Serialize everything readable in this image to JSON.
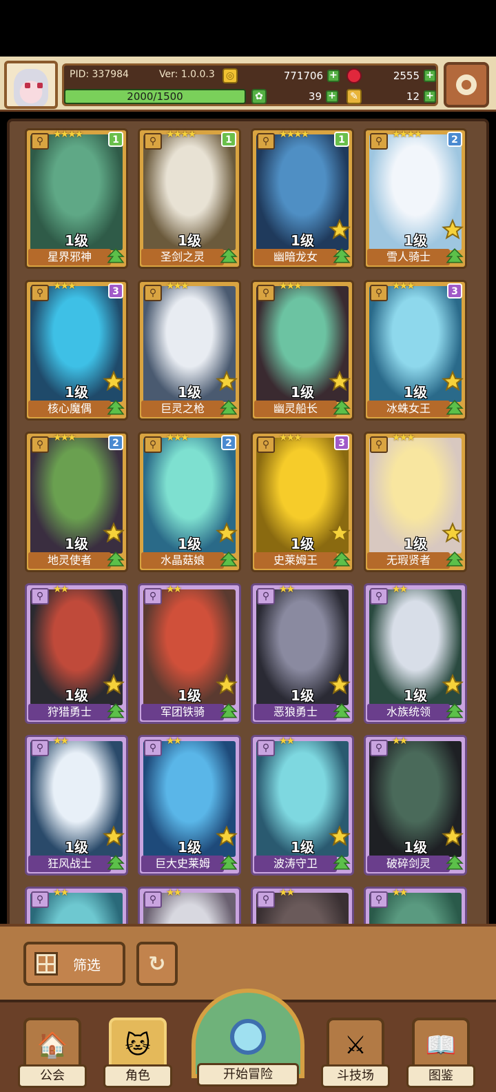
{
  "header": {
    "pid": "PID: 337984",
    "version": "Ver: 1.0.0.3",
    "gold": "771706",
    "gems": "2555",
    "exp": "2000/1500",
    "exp_progress": 1.0,
    "clover": "39",
    "tickets": "12"
  },
  "cards": [
    {
      "name": "星界邪神",
      "level": "1级",
      "stars": "★★★★",
      "badge": "1",
      "rarity": "gold",
      "badge_color": "#6abf4b",
      "art": [
        "#2f5b48",
        "#5fa886"
      ]
    },
    {
      "name": "圣剑之灵",
      "level": "1级",
      "stars": "★★★★",
      "badge": "1",
      "rarity": "gold",
      "badge_color": "#6abf4b",
      "art": [
        "#6b5a3c",
        "#e8e2d4"
      ]
    },
    {
      "name": "幽暗龙女",
      "level": "1级",
      "stars": "★★★★",
      "badge": "1",
      "rarity": "gold",
      "badge_color": "#6abf4b",
      "art": [
        "#1f3a5c",
        "#4f8fc4"
      ]
    },
    {
      "name": "雪人骑士",
      "level": "1级",
      "stars": "★★★★",
      "badge": "2",
      "rarity": "gold",
      "badge_color": "#4a8ad0",
      "art": [
        "#9ec6e0",
        "#f2f6fb"
      ]
    },
    {
      "name": "核心魔偶",
      "level": "1级",
      "stars": "★★★",
      "badge": "3",
      "rarity": "gold",
      "badge_color": "#a05ac8",
      "art": [
        "#1f4a6a",
        "#3ec0e6"
      ]
    },
    {
      "name": "巨灵之枪",
      "level": "1级",
      "stars": "★★★",
      "badge": "",
      "rarity": "gold",
      "badge_color": "",
      "art": [
        "#4a5a70",
        "#e8ecf2"
      ]
    },
    {
      "name": "幽灵船长",
      "level": "1级",
      "stars": "★★★",
      "badge": "",
      "rarity": "gold",
      "badge_color": "",
      "art": [
        "#3a2a30",
        "#6cc3a2"
      ]
    },
    {
      "name": "冰蛛女王",
      "level": "1级",
      "stars": "★★★",
      "badge": "3",
      "rarity": "gold",
      "badge_color": "#a05ac8",
      "art": [
        "#2a6a8a",
        "#8ed8ec"
      ]
    },
    {
      "name": "地灵使者",
      "level": "1级",
      "stars": "★★★",
      "badge": "2",
      "rarity": "gold",
      "badge_color": "#4a8ad0",
      "art": [
        "#3a2e40",
        "#6aa050"
      ]
    },
    {
      "name": "水晶菇娘",
      "level": "1级",
      "stars": "★★★",
      "badge": "2",
      "rarity": "gold",
      "badge_color": "#4a8ad0",
      "art": [
        "#2a6a88",
        "#7ee0d0"
      ]
    },
    {
      "name": "史莱姆王",
      "level": "1级",
      "stars": "★★★",
      "badge": "3",
      "rarity": "gold",
      "badge_color": "#a05ac8",
      "art": [
        "#8a6a10",
        "#f6cc2a"
      ]
    },
    {
      "name": "无瑕贤者",
      "level": "1级",
      "stars": "★★★",
      "badge": "",
      "rarity": "gold",
      "badge_color": "",
      "art": [
        "#d8c8c0",
        "#f8e6a0"
      ]
    },
    {
      "name": "狩猎勇士",
      "level": "1级",
      "stars": "★★",
      "badge": "",
      "rarity": "purple",
      "badge_color": "",
      "art": [
        "#2a2a30",
        "#c04a3a"
      ]
    },
    {
      "name": "军团铁骑",
      "level": "1级",
      "stars": "★★",
      "badge": "",
      "rarity": "purple",
      "badge_color": "",
      "art": [
        "#5a3a30",
        "#d0503a"
      ]
    },
    {
      "name": "恶狼勇士",
      "level": "1级",
      "stars": "★★",
      "badge": "",
      "rarity": "purple",
      "badge_color": "",
      "art": [
        "#2a2a34",
        "#8a8aa0"
      ]
    },
    {
      "name": "水族统领",
      "level": "1级",
      "stars": "★★",
      "badge": "",
      "rarity": "purple",
      "badge_color": "",
      "art": [
        "#2a4a40",
        "#d8dee8"
      ]
    },
    {
      "name": "狂风战士",
      "level": "1级",
      "stars": "★★",
      "badge": "",
      "rarity": "purple",
      "badge_color": "",
      "art": [
        "#2a4a6a",
        "#e8f0f8"
      ]
    },
    {
      "name": "巨大史莱姆",
      "level": "1级",
      "stars": "★★",
      "badge": "",
      "rarity": "purple",
      "badge_color": "",
      "art": [
        "#1e4a7a",
        "#5ab6e8"
      ]
    },
    {
      "name": "波涛守卫",
      "level": "1级",
      "stars": "★★",
      "badge": "",
      "rarity": "purple",
      "badge_color": "",
      "art": [
        "#2a5a70",
        "#7ed8e0"
      ]
    },
    {
      "name": "破碎剑灵",
      "level": "1级",
      "stars": "★★",
      "badge": "",
      "rarity": "purple",
      "badge_color": "",
      "art": [
        "#1e2024",
        "#4a6a5a"
      ]
    },
    {
      "name": "",
      "level": "",
      "stars": "★★",
      "badge": "",
      "rarity": "purple",
      "badge_color": "",
      "art": [
        "#2a6a7a",
        "#6ec8d0"
      ]
    },
    {
      "name": "",
      "level": "",
      "stars": "★★",
      "badge": "",
      "rarity": "purple",
      "badge_color": "",
      "art": [
        "#6a6070",
        "#d8d8e0"
      ]
    },
    {
      "name": "",
      "level": "",
      "stars": "★★",
      "badge": "",
      "rarity": "purple",
      "badge_color": "",
      "art": [
        "#3a3032",
        "#6a5a5a"
      ]
    },
    {
      "name": "",
      "level": "",
      "stars": "★★",
      "badge": "",
      "rarity": "purple",
      "badge_color": "",
      "art": [
        "#2a5a4a",
        "#5a9a80"
      ]
    }
  ],
  "controls": {
    "filter_label": "筛选",
    "refresh_icon": "refresh-icon"
  },
  "nav": {
    "guild": "公会",
    "characters": "角色",
    "adventure": "开始冒险",
    "arena": "斗技场",
    "codex": "图鉴"
  }
}
